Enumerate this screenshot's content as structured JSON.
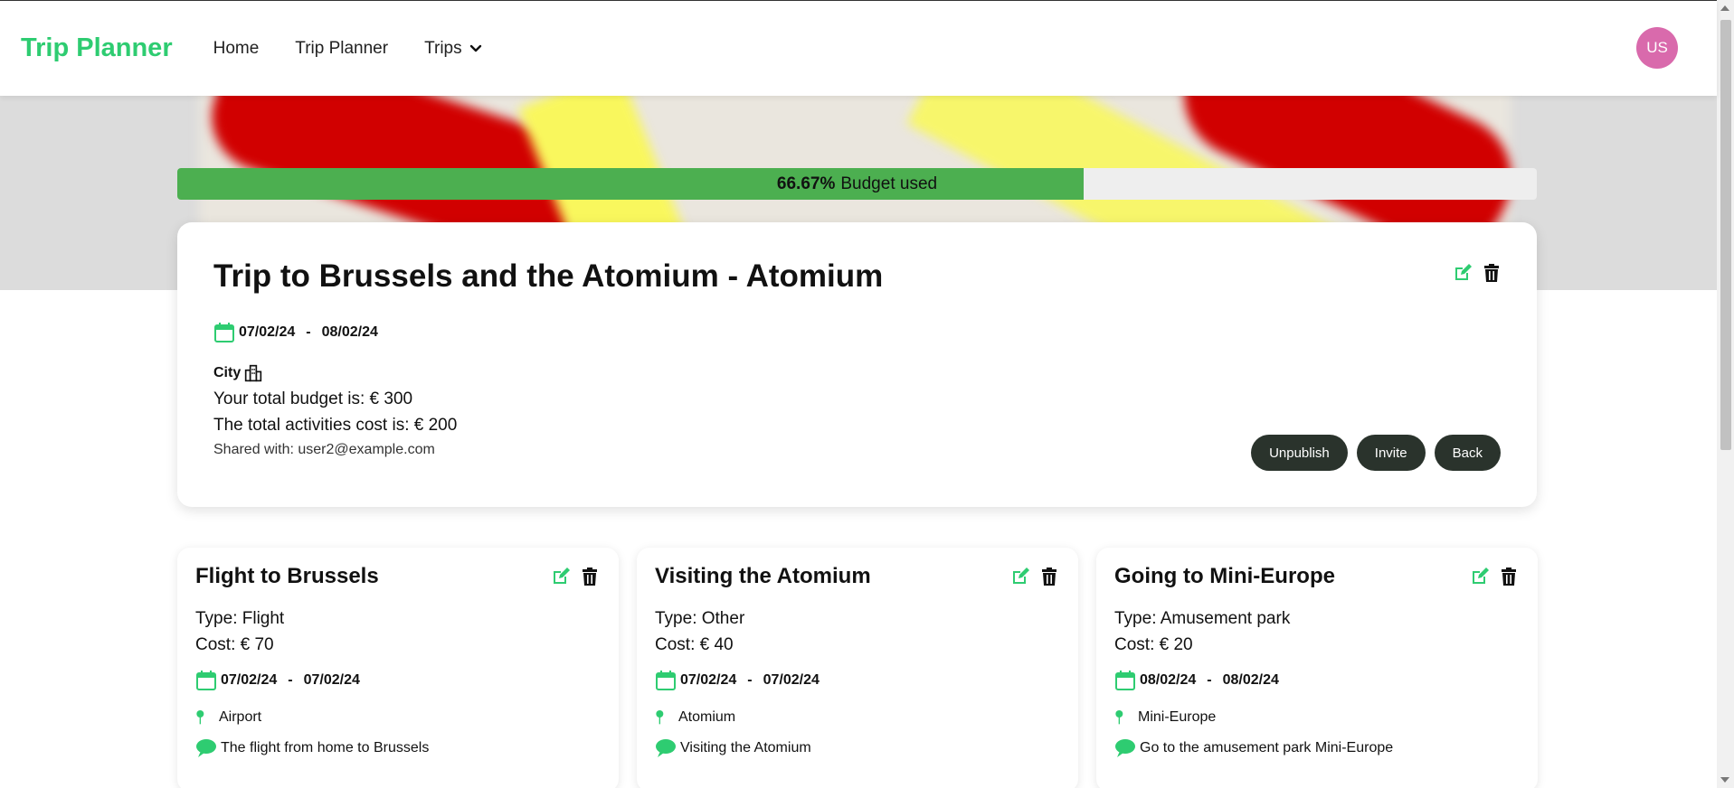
{
  "navbar": {
    "brand": "Trip Planner",
    "links": [
      {
        "label": "Home"
      },
      {
        "label": "Trip Planner"
      },
      {
        "label": "Trips"
      }
    ],
    "avatar_initials": "US"
  },
  "budget_progress": {
    "percent_text": "66.67%",
    "label": "Budget used",
    "fraction": 0.6667
  },
  "trip": {
    "title": "Trip to Brussels and the Atomium - Atomium",
    "start_date": "07/02/24",
    "date_sep": "-",
    "end_date": "08/02/24",
    "type": "City",
    "budget_text": "Your total budget is: € 300",
    "cost_text": "The total activities cost is: € 200",
    "shared_text": "Shared with: user2@example.com",
    "buttons": {
      "unpublish": "Unpublish",
      "invite": "Invite",
      "back": "Back"
    }
  },
  "activities": [
    {
      "title": "Flight to Brussels",
      "type_text": "Type: Flight",
      "cost_text": "Cost: € 70",
      "start_date": "07/02/24",
      "end_date": "07/02/24",
      "location": "Airport",
      "description": "The flight from home to Brussels"
    },
    {
      "title": "Visiting the Atomium",
      "type_text": "Type: Other",
      "cost_text": "Cost: € 40",
      "start_date": "07/02/24",
      "end_date": "07/02/24",
      "location": "Atomium",
      "description": "Visiting the Atomium"
    },
    {
      "title": "Going to Mini-Europe",
      "type_text": "Type: Amusement park",
      "cost_text": "Cost: € 20",
      "start_date": "08/02/24",
      "end_date": "08/02/24",
      "location": "Mini-Europe",
      "description": "Go to the amusement park Mini-Europe"
    }
  ],
  "colors": {
    "brand": "#2ecc71",
    "progress_fill": "#4caf50",
    "button_bg": "#2a332c",
    "avatar_bg": "#d96aac"
  },
  "icons": {
    "edit": "edit-icon",
    "delete": "trash-icon",
    "calendar": "calendar-icon",
    "location": "pin-icon",
    "comment": "comment-icon",
    "city": "city-icon",
    "dropdown": "chevron-down-icon"
  }
}
